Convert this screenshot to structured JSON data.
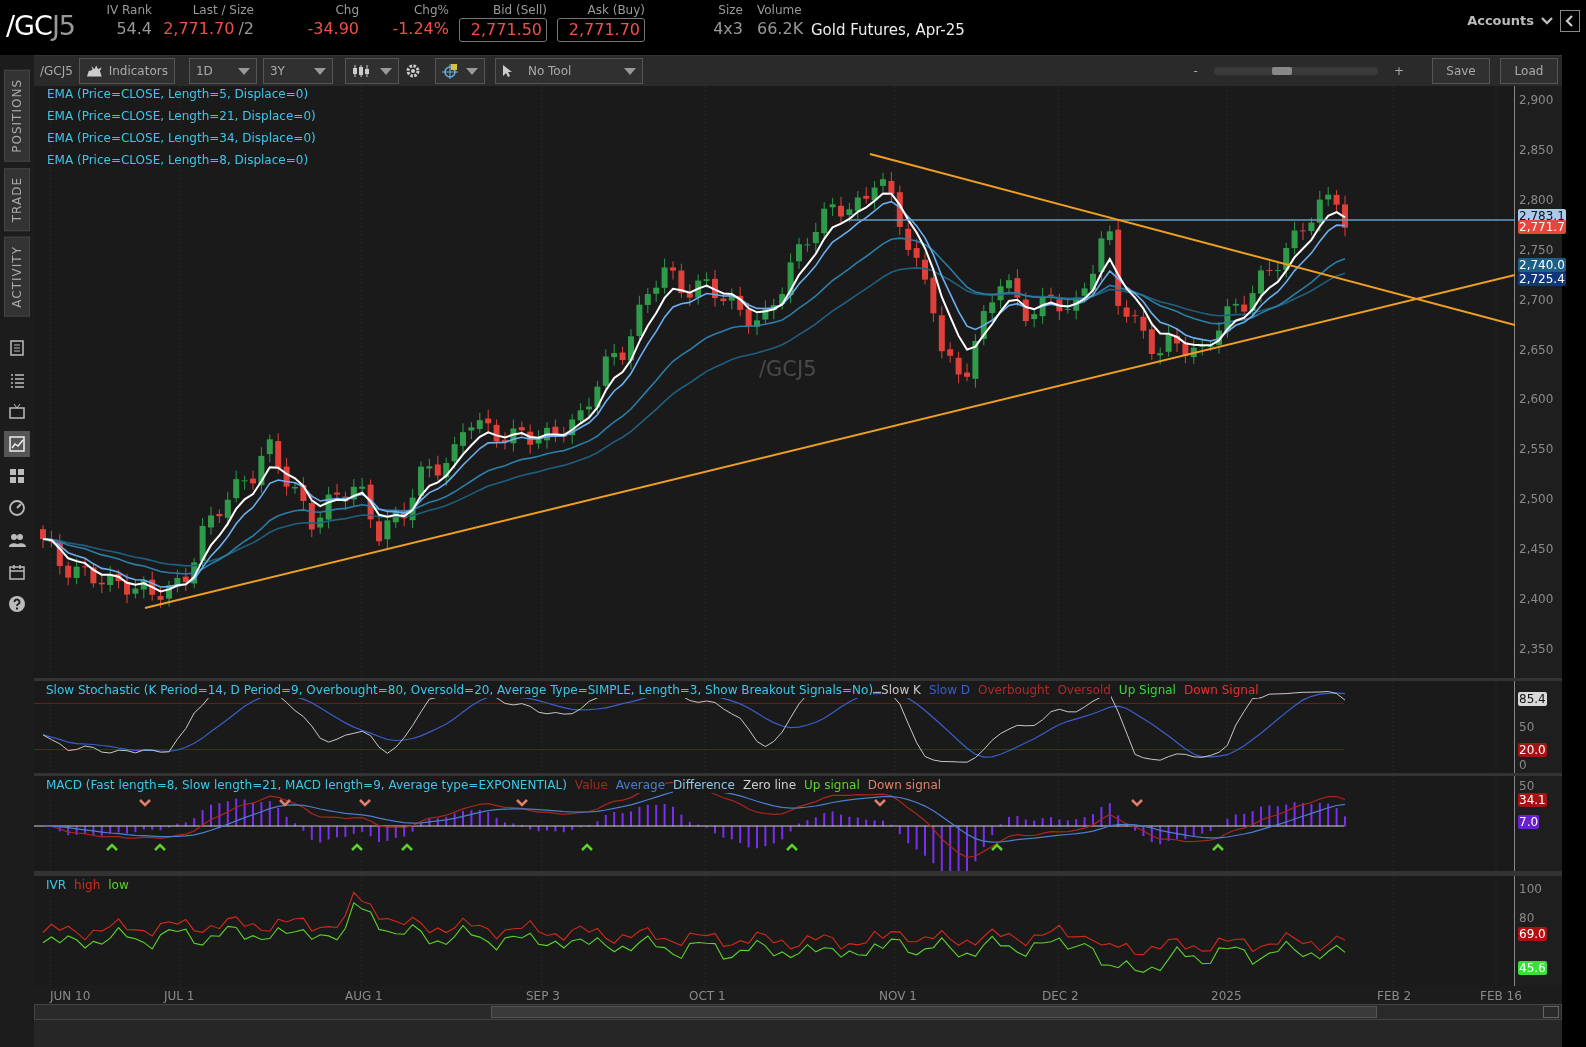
{
  "header": {
    "symbol": "/GC",
    "symbol_contract": "J5",
    "quotes": [
      {
        "label": "IV Rank",
        "value": "54.4",
        "kind": "plain"
      },
      {
        "label": "Last / Size",
        "value": "2,771.70",
        "size": "/2",
        "kind": "down"
      },
      {
        "label": "Chg",
        "value": "-34.90",
        "kind": "down"
      },
      {
        "label": "Chg%",
        "value": "-1.24%",
        "kind": "down"
      },
      {
        "label": "Bid (Sell)",
        "value": "2,771.50",
        "kind": "boxed"
      },
      {
        "label": "Ask (Buy)",
        "value": "2,771.70",
        "kind": "boxed"
      },
      {
        "label": "Size",
        "value": "4x3",
        "kind": "plain"
      },
      {
        "label": "Volume",
        "value": "66.2K",
        "kind": "plain"
      }
    ],
    "description": "Gold Futures, Apr-25",
    "accounts": "Accounts"
  },
  "side_tabs": [
    {
      "label": "POSITIONS"
    },
    {
      "label": "TRADE"
    },
    {
      "label": "ACTIVITY"
    }
  ],
  "side_icons": [
    {
      "kind": "document",
      "selected": false
    },
    {
      "kind": "list",
      "selected": false
    },
    {
      "kind": "tv",
      "selected": false
    },
    {
      "kind": "chart",
      "selected": true
    },
    {
      "kind": "grid",
      "selected": false
    },
    {
      "kind": "gauge",
      "selected": false
    },
    {
      "kind": "people",
      "selected": false
    },
    {
      "kind": "calendar",
      "selected": false
    },
    {
      "kind": "help",
      "selected": false
    }
  ],
  "toolbar": {
    "symbol": "/GCJ5",
    "indicators": "Indicators",
    "aggregation": "1D",
    "range": "3Y",
    "tool": "No Tool",
    "zoom_minus": "-",
    "zoom_plus": "+",
    "zoom_slider": {
      "level": 0.4
    },
    "save": "Save",
    "load": "Load"
  },
  "price_panel": {
    "watermark": "/GCJ5",
    "studies": [
      "EMA (Price=CLOSE, Length=5, Displace=0)",
      "EMA (Price=CLOSE, Length=21, Displace=0)",
      "EMA (Price=CLOSE, Length=34, Displace=0)",
      "EMA (Price=CLOSE, Length=8, Displace=0)"
    ],
    "axis_ticks": [
      "2,900",
      "2,850",
      "2,800",
      "2,750",
      "2,700",
      "2,650",
      "2,600",
      "2,550",
      "2,500",
      "2,450",
      "2,400",
      "2,350"
    ],
    "markers": [
      {
        "text": "2,783.1",
        "color": "#a9cbe8"
      },
      {
        "text": "2,771.7",
        "color": "#e8453c"
      },
      {
        "text": "2,740.0",
        "color": "#1d5f86"
      },
      {
        "text": "2,725.4",
        "color": "#12367e"
      }
    ]
  },
  "stochastic_panel": {
    "title": "Slow Stochastic (K Period=14, D Period=9, Overbought=80, Oversold=20, Average Type=SIMPLE, Length=3, Show Breakout Signals=No)",
    "legend": [
      {
        "label": "Slow K",
        "color": "#c8c8c8"
      },
      {
        "label": "Slow D",
        "color": "#3a5fcd"
      },
      {
        "label": "Overbought",
        "color": "#b02a2a"
      },
      {
        "label": "Oversold",
        "color": "#b02a2a"
      },
      {
        "label": "Up Signal",
        "color": "#3ad43a"
      },
      {
        "label": "Down Signal",
        "color": "#e83030"
      }
    ],
    "axis_ticks": [
      "50",
      "0"
    ],
    "markers": [
      {
        "text": "85.4",
        "color": "#d8d8d8"
      },
      {
        "text": "20.0",
        "color": "#a31515"
      }
    ]
  },
  "macd_panel": {
    "title": "MACD (Fast length=8, Slow length=21, MACD length=9, Average type=EXPONENTIAL)",
    "legend": [
      {
        "label": "Value",
        "color": "#a8281c"
      },
      {
        "label": "Average",
        "color": "#4a7fd0"
      },
      {
        "label": "Difference",
        "color": "#8fc8e8"
      },
      {
        "label": "Zero line",
        "color": "#d0d0d0"
      },
      {
        "label": "Up signal",
        "color": "#5ad42a"
      },
      {
        "label": "Down signal",
        "color": "#e0806a"
      }
    ],
    "axis_ticks": [
      "50"
    ],
    "markers": [
      {
        "text": "34.1",
        "color": "#a31515"
      },
      {
        "text": "7.0",
        "color": "#6a1fd0"
      }
    ]
  },
  "ivr_panel": {
    "legend": [
      {
        "label": "IVR",
        "color": "#3ec6e8"
      },
      {
        "label": "high",
        "color": "#d42a1a"
      },
      {
        "label": "low",
        "color": "#5ad42a"
      }
    ],
    "axis_ticks": [
      "100",
      "80"
    ],
    "markers": [
      {
        "text": "69.0",
        "color": "#b01010"
      },
      {
        "text": "45.6",
        "color": "#3ae03a"
      }
    ]
  },
  "x_axis": [
    "JUN 10",
    "JUL 1",
    "AUG 1",
    "SEP 3",
    "OCT 1",
    "NOV 1",
    "DEC 2",
    "2025",
    "FEB 2",
    "FEB 16"
  ]
}
